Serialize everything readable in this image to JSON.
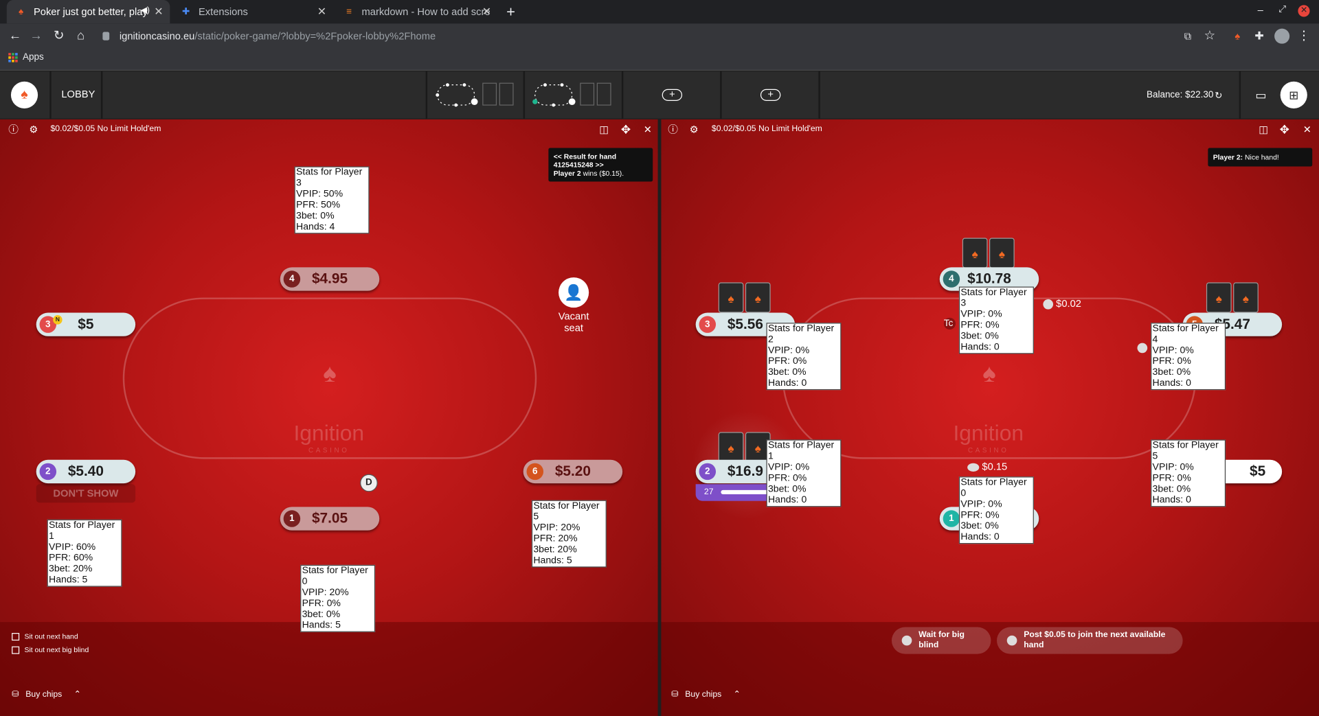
{
  "browser": {
    "tabs": [
      {
        "title": "Poker just got better, play",
        "active": true
      },
      {
        "title": "Extensions",
        "active": false
      },
      {
        "title": "markdown - How to add scre",
        "active": false
      }
    ],
    "url_host": "ignitioncasino.eu",
    "url_path": "/static/poker-game/?lobby=%2Fpoker-lobby%2Fhome",
    "bookmarks_apps": "Apps"
  },
  "game_header": {
    "lobby_label": "LOBBY",
    "balance": "Balance: $22.30",
    "add_table_glyph": "+"
  },
  "tables": [
    {
      "title": "$0.02/$0.05 No Limit Hold'em",
      "result_box": {
        "line1": "<< Result for hand",
        "line2": "4125415248 >>",
        "winner": "Player 2",
        "wins_text": "wins ($0.15)."
      },
      "brand": "Ignition",
      "brand_sub": "CASINO",
      "seats": [
        {
          "num": "4",
          "amount": "$4.95",
          "color": "#7a2020"
        },
        {
          "num": "3",
          "amount": "$5",
          "color": "#e34b4b",
          "badge": "N"
        },
        {
          "num": "2",
          "amount": "$5.40",
          "color": "#7e4fc9",
          "status": "DON'T SHOW"
        },
        {
          "num": "1",
          "amount": "$7.05",
          "color": "#7a2020"
        },
        {
          "num": "6",
          "amount": "$5.20",
          "color": "#d4541e"
        }
      ],
      "vacant": "Vacant seat",
      "dealer": "D",
      "stats": [
        {
          "title": "Stats for Player 3",
          "vpip": "VPIP: 50%",
          "pfr": "PFR: 50%",
          "bet3": "3bet: 0%",
          "hands": "Hands: 4"
        },
        {
          "title": "Stats for Player 1",
          "vpip": "VPIP: 60%",
          "pfr": "PFR: 60%",
          "bet3": "3bet: 20%",
          "hands": "Hands: 5"
        },
        {
          "title": "Stats for Player 5",
          "vpip": "VPIP: 20%",
          "pfr": "PFR: 20%",
          "bet3": "3bet: 20%",
          "hands": "Hands: 5"
        },
        {
          "title": "Stats for Player 0",
          "vpip": "VPIP: 20%",
          "pfr": "PFR: 0%",
          "bet3": "3bet: 0%",
          "hands": "Hands: 5"
        }
      ],
      "sit_out_next_hand": "Sit out next hand",
      "sit_out_next_bb": "Sit out next big blind",
      "buy_chips": "Buy chips"
    },
    {
      "title": "$0.02/$0.05 No Limit Hold'em",
      "chat_name": "Player 2:",
      "chat_msg": "Nice hand!",
      "brand": "Ignition",
      "brand_sub": "CASINO",
      "seats": [
        {
          "num": "4",
          "amount": "$10.78",
          "color": "#2e6e6e"
        },
        {
          "num": "3",
          "amount": "$5.56",
          "color": "#e34b4b"
        },
        {
          "num": "5",
          "amount": "$5.47",
          "color": "#d4541e"
        },
        {
          "num": "2",
          "amount": "$16.9",
          "color": "#7e4fc9",
          "timer": "27"
        },
        {
          "num": "1",
          "amount": "",
          "color": "#1fb5a5"
        },
        {
          "num": "",
          "amount": "$5",
          "color": "#ffffff"
        }
      ],
      "bets": {
        "top": "$0.02",
        "mid": "$0.15"
      },
      "partial_text": "Tc",
      "stats": [
        {
          "title": "Stats for Player 3",
          "vpip": "VPIP: 0%",
          "pfr": "PFR: 0%",
          "bet3": "3bet: 0%",
          "hands": "Hands: 0"
        },
        {
          "title": "Stats for Player 2",
          "vpip": "VPIP: 0%",
          "pfr": "PFR: 0%",
          "bet3": "3bet: 0%",
          "hands": "Hands: 0"
        },
        {
          "title": "Stats for Player 4",
          "vpip": "VPIP: 0%",
          "pfr": "PFR: 0%",
          "bet3": "3bet: 0%",
          "hands": "Hands: 0"
        },
        {
          "title": "Stats for Player 1",
          "vpip": "VPIP: 0%",
          "pfr": "PFR: 0%",
          "bet3": "3bet: 0%",
          "hands": "Hands: 0"
        },
        {
          "title": "Stats for Player 5",
          "vpip": "VPIP: 0%",
          "pfr": "PFR: 0%",
          "bet3": "3bet: 0%",
          "hands": "Hands: 0"
        },
        {
          "title": "Stats for Player 0",
          "vpip": "VPIP: 0%",
          "pfr": "PFR: 0%",
          "bet3": "3bet: 0%",
          "hands": "Hands: 0"
        }
      ],
      "wait_bb": "Wait for big blind",
      "post_bb": "Post $0.05 to join the next available hand",
      "buy_chips": "Buy chips"
    }
  ]
}
